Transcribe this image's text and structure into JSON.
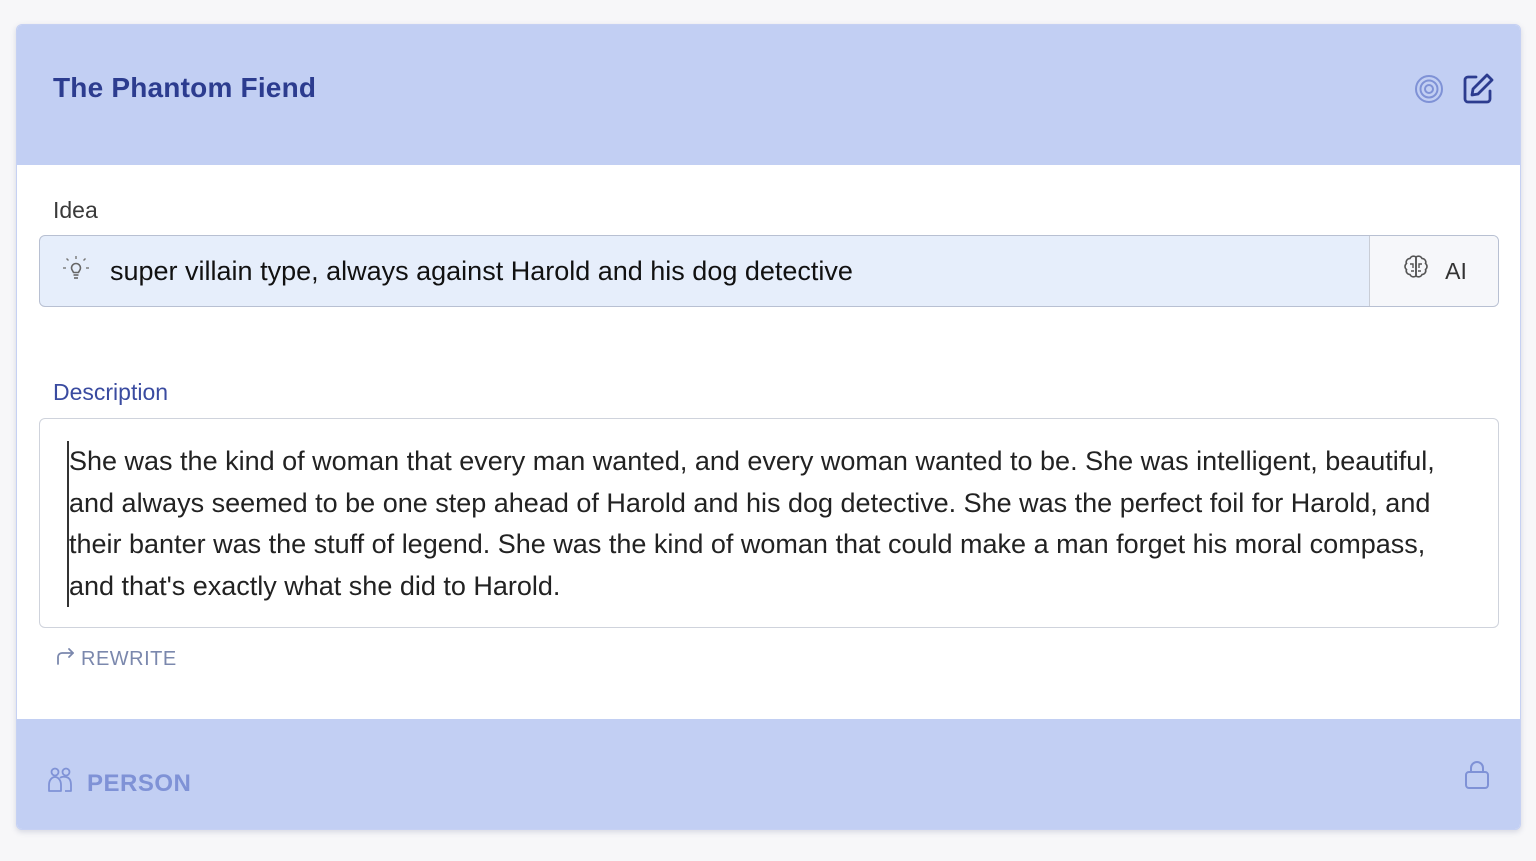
{
  "card": {
    "title": "The Phantom Fiend",
    "header_icons": [
      "target-icon",
      "edit-icon"
    ]
  },
  "idea": {
    "label": "Idea",
    "value": "super villain type, always against Harold and his dog detective",
    "icon": "lightbulb-icon",
    "ai_button_label": "AI",
    "ai_button_icon": "brain-icon"
  },
  "description": {
    "label": "Description",
    "text": "She was the kind of woman that every man wanted, and every woman wanted to be. She was intelligent, beautiful, and always seemed to be one step ahead of Harold and his dog detective. She was the perfect foil for Harold, and their banter was the stuff of legend. She was the kind of woman that could make a man forget his moral compass, and that's exactly what she did to Harold.",
    "rewrite_label": "REWRITE",
    "rewrite_icon": "redo-arrow-icon"
  },
  "footer": {
    "type_label": "PERSON",
    "type_icon": "people-icon",
    "lock_icon": "lock-icon"
  },
  "colors": {
    "header_bg": "#c2cff3",
    "title": "#2c3c8f",
    "idea_bg": "#e6eefb",
    "footer_text": "#7f92d6"
  }
}
